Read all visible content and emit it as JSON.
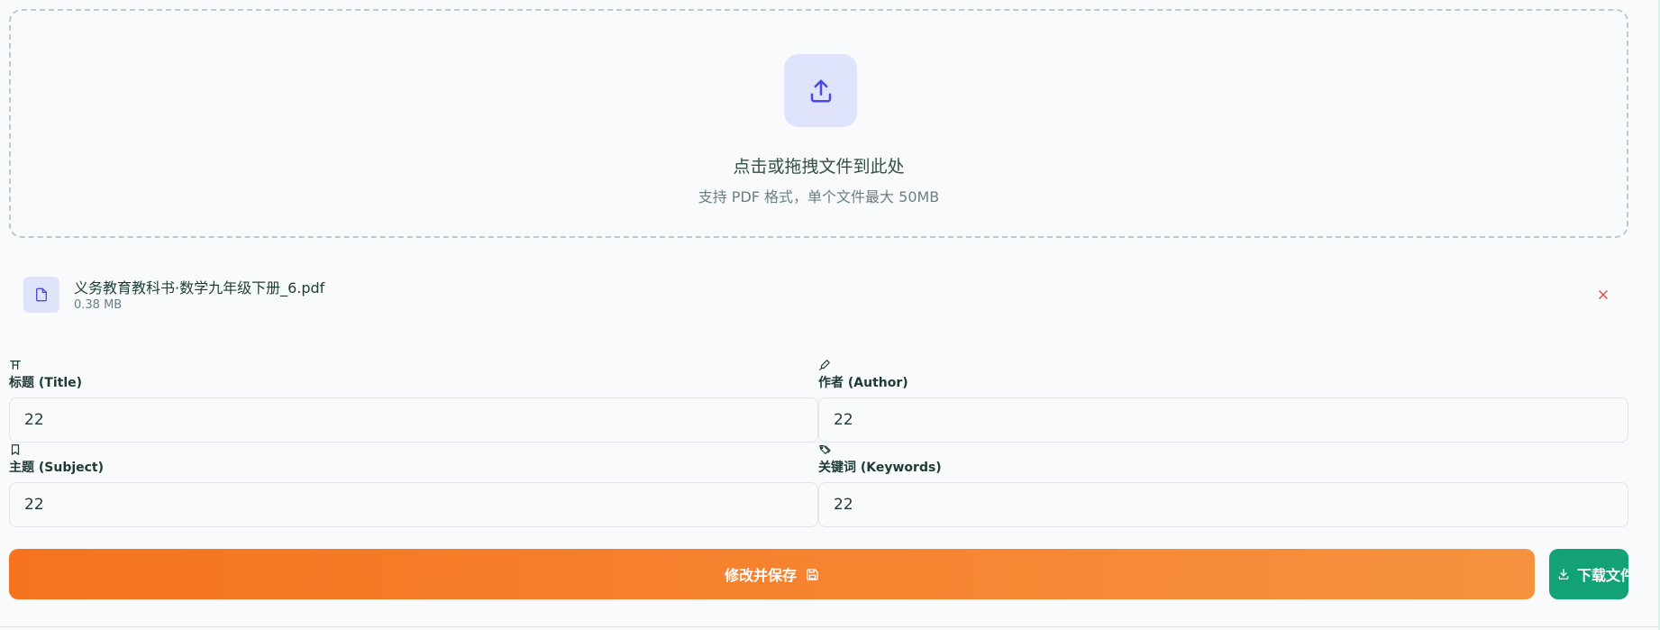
{
  "upload": {
    "title": "点击或拖拽文件到此处",
    "hint": "支持 PDF 格式，单个文件最大 50MB",
    "icon": "upload-icon"
  },
  "file": {
    "name": "义务教育教科书·数学九年级下册_6.pdf",
    "size": "0.38 MB",
    "icon": "file-icon",
    "remove_icon": "close-icon"
  },
  "fields": {
    "title": {
      "label": "标题 (Title)",
      "value": "22",
      "icon": "heading-icon"
    },
    "author": {
      "label": "作者 (Author)",
      "value": "22",
      "icon": "pen-icon"
    },
    "subject": {
      "label": "主题 (Subject)",
      "value": "22",
      "icon": "bookmark-icon"
    },
    "keywords": {
      "label": "关键词 (Keywords)",
      "value": "22",
      "icon": "tags-icon"
    }
  },
  "actions": {
    "save_label": "修改并保存",
    "save_icon": "save-icon",
    "download_label": "下载文件",
    "download_icon": "download-icon"
  },
  "colors": {
    "accent_indigo": "#4f46e5",
    "upload_badge_bg": "#dfe3fb",
    "save_gradient_start": "#f5731f",
    "save_gradient_end": "#f6923f",
    "download_bg": "#13a277",
    "remove_red": "#e5484d"
  }
}
